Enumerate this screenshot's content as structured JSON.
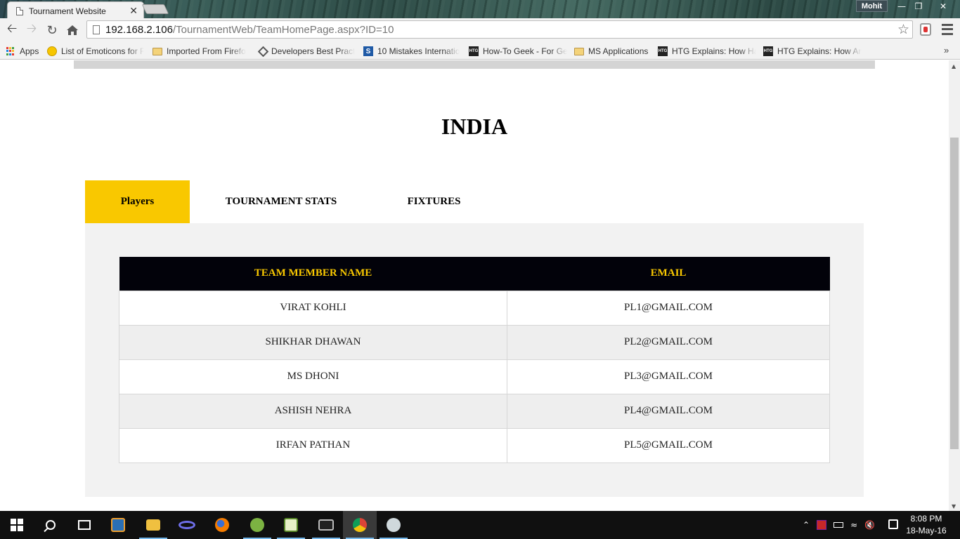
{
  "browser": {
    "tab_title": "Tournament Website",
    "profile_name": "Mohit",
    "url_host": "192.168.2.106",
    "url_path": "/TournamentWeb/TeamHomePage.aspx?ID=10",
    "bookmarks": [
      {
        "label": "Apps",
        "icon": "apps-icon"
      },
      {
        "label": "List of Emoticons for F",
        "icon": "emoticon-icon"
      },
      {
        "label": "Imported From Firefo",
        "icon": "folder-icon"
      },
      {
        "label": "Developers Best Pract",
        "icon": "developer-icon"
      },
      {
        "label": "10 Mistakes Internatio",
        "icon": "stackoverflow-icon"
      },
      {
        "label": "How-To Geek - For Ge",
        "icon": "htg-icon"
      },
      {
        "label": "MS Applications",
        "icon": "folder-icon"
      },
      {
        "label": "HTG Explains: How Ha",
        "icon": "htg-icon"
      },
      {
        "label": "HTG Explains: How An",
        "icon": "htg-icon"
      }
    ]
  },
  "page": {
    "team_name": "INDIA",
    "tabs": [
      {
        "label": "Players",
        "active": true
      },
      {
        "label": "TOURNAMENT STATS",
        "active": false
      },
      {
        "label": "FIXTURES",
        "active": false
      }
    ],
    "table": {
      "headers": [
        "TEAM MEMBER NAME",
        "EMAIL"
      ],
      "rows": [
        [
          "VIRAT KOHLI",
          "PL1@GMAIL.COM"
        ],
        [
          "SHIKHAR DHAWAN",
          "PL2@GMAIL.COM"
        ],
        [
          "MS DHONI",
          "PL3@GMAIL.COM"
        ],
        [
          "ASHISH NEHRA",
          "PL4@GMAIL.COM"
        ],
        [
          "IRFAN PATHAN",
          "PL5@GMAIL.COM"
        ]
      ]
    }
  },
  "taskbar": {
    "time": "8:08 PM",
    "date": "18-May-16"
  },
  "colors": {
    "accent_yellow": "#f9c800",
    "header_dark": "#02020a",
    "panel_bg": "#f2f2f2"
  }
}
